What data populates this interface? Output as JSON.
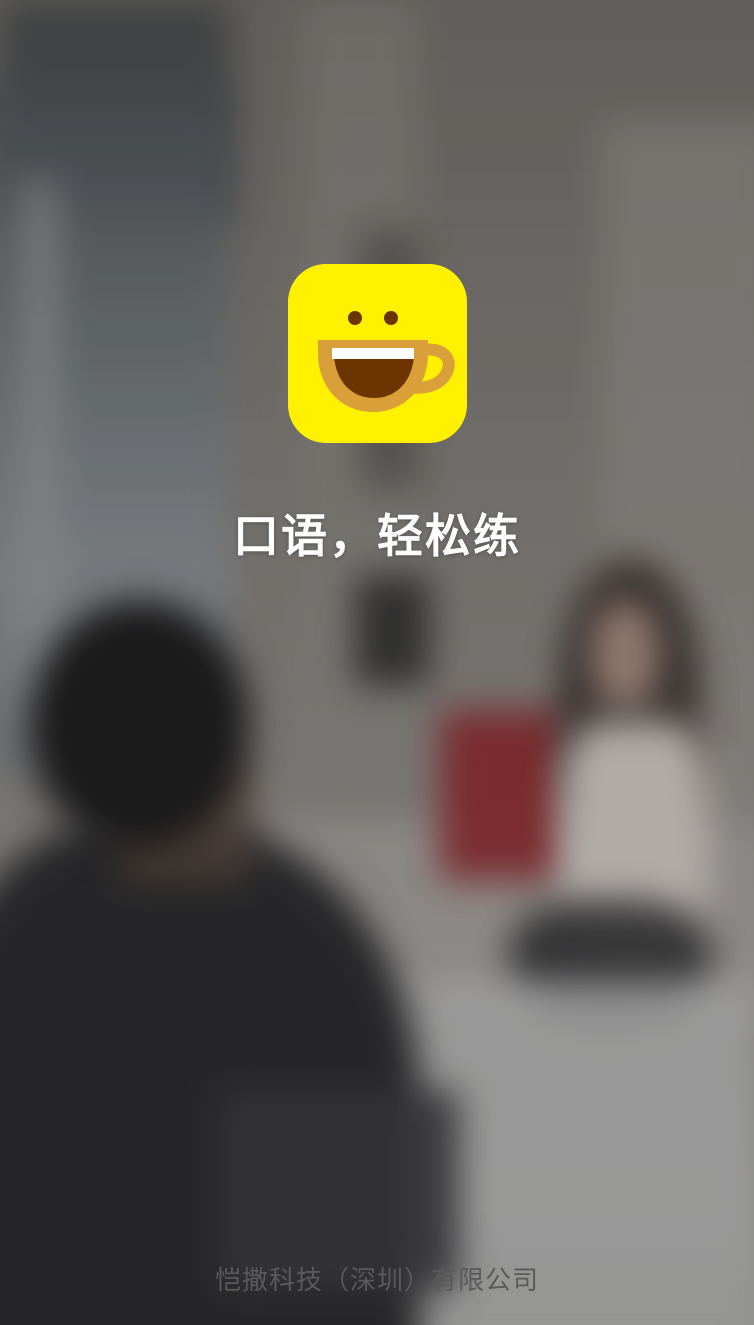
{
  "app": {
    "logo_icon": "smiling-coffee-cup-icon",
    "slogan": "口语，轻松练",
    "company": "恺撒科技（深圳）有限公司"
  },
  "colors": {
    "logo_background": "#fff100",
    "cup_body": "#d9a03a",
    "cup_inner": "#6b3400",
    "slogan_text": "#ffffff",
    "company_text": "#5a5a5a"
  }
}
